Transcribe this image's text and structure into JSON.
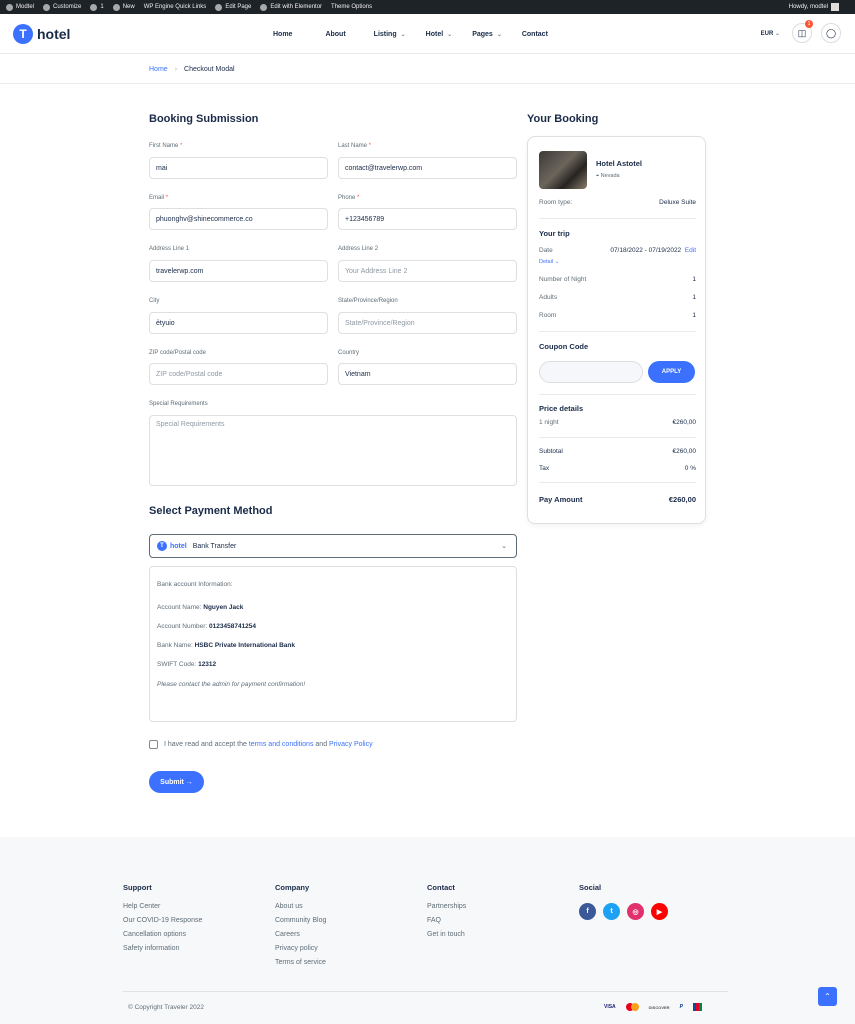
{
  "adminbar": {
    "items": [
      "Modtel",
      "Customize",
      "1",
      "New",
      "WP Engine Quick Links",
      "Edit Page",
      "Edit with Elementor",
      "Theme Options"
    ],
    "howdy": "Howdy, modtel"
  },
  "header": {
    "logo_mark": "T",
    "logo_text": "hotel",
    "nav": [
      "Home",
      "About",
      "Listing",
      "Hotel",
      "Pages",
      "Contact"
    ],
    "currency": "EUR",
    "cart_count": "1"
  },
  "breadcrumb": {
    "home": "Home",
    "current": "Checkout Modal"
  },
  "form": {
    "title": "Booking Submission",
    "first_name": {
      "label": "First Name",
      "value": "mai"
    },
    "last_name": {
      "label": "Last Name",
      "value": "contact@travelerwp.com"
    },
    "email": {
      "label": "Email",
      "value": "phuonghv@shinecommerce.co"
    },
    "phone": {
      "label": "Phone",
      "value": "+123456789"
    },
    "address1": {
      "label": "Address Line 1",
      "value": "travelerwp.com"
    },
    "address2": {
      "label": "Address Line 2",
      "placeholder": "Your Address Line 2"
    },
    "city": {
      "label": "City",
      "value": "ẻtyuio"
    },
    "state": {
      "label": "State/Province/Region",
      "placeholder": "State/Province/Region"
    },
    "zip": {
      "label": "ZIP code/Postal code",
      "placeholder": "ZIP code/Postal code"
    },
    "country": {
      "label": "Country",
      "value": "Vietnam"
    },
    "special": {
      "label": "Special Requirements",
      "placeholder": "Special Requirements"
    },
    "required_mark": "*"
  },
  "payment": {
    "title": "Select Payment Method",
    "logo_text": "hotel",
    "selected": "Bank Transfer",
    "bank_info_title": "Bank account Information:",
    "account_name_label": "Account Name:",
    "account_name": "Nguyen Jack",
    "account_number_label": "Account Number:",
    "account_number": "0123458741254",
    "bank_name_label": "Bank Name:",
    "bank_name": "HSBC Private International Bank",
    "swift_label": "SWIFT Code:",
    "swift": "12312",
    "note": "Please contact the admin for payment confirmation!"
  },
  "terms": {
    "prefix": "I have read and accept the",
    "terms_link": "terms and conditions",
    "and": "and",
    "privacy_link": "Privacy Policy"
  },
  "submit_label": "Submit →",
  "booking": {
    "title": "Your Booking",
    "hotel_name": "Hotel Astotel",
    "location": "Nevada",
    "room_type_label": "Room type:",
    "room_type": "Deluxe Suite",
    "trip_title": "Your trip",
    "date_label": "Date",
    "date_value": "07/18/2022 - 07/19/2022",
    "edit": "Edit",
    "detail": "Detail",
    "nights_label": "Number of Night",
    "nights": "1",
    "adults_label": "Adults",
    "adults": "1",
    "room_label": "Room",
    "room": "1",
    "coupon_title": "Coupon Code",
    "apply": "APPLY",
    "price_title": "Price details",
    "one_night_label": "1 night",
    "one_night": "€260,00",
    "subtotal_label": "Subtotal",
    "subtotal": "€260,00",
    "tax_label": "Tax",
    "tax": "0 %",
    "pay_label": "Pay Amount",
    "pay": "€260,00"
  },
  "footer": {
    "support": {
      "title": "Support",
      "links": [
        "Help Center",
        "Our COVID-19 Response",
        "Cancellation options",
        "Safety information"
      ]
    },
    "company": {
      "title": "Company",
      "links": [
        "About us",
        "Community Blog",
        "Careers",
        "Privacy policy",
        "Terms of service"
      ]
    },
    "contact": {
      "title": "Contact",
      "links": [
        "Partnerships",
        "FAQ",
        "Get in touch"
      ]
    },
    "social": {
      "title": "Social",
      "icons": [
        "facebook-icon",
        "twitter-icon",
        "instagram-icon",
        "youtube-icon"
      ]
    },
    "copyright": "© Copyright Traveler 2022",
    "payment_cards": [
      "VISA",
      "DISCOVER",
      "P"
    ]
  },
  "colors": {
    "accent": "#3b71fe",
    "dark": "#1a2b48",
    "muted": "#5e6d77"
  }
}
